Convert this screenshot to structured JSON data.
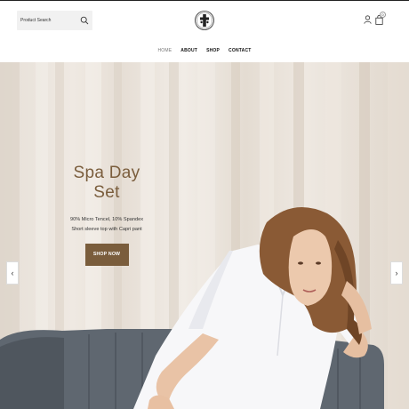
{
  "header": {
    "search": {
      "placeholder": "Product Search",
      "icon": "search-icon"
    },
    "logo": "brand-logo",
    "cart_count": "0"
  },
  "nav": {
    "items": [
      {
        "label": "HOME",
        "active": true
      },
      {
        "label": "ABOUT",
        "active": false
      },
      {
        "label": "SHOP",
        "active": false
      },
      {
        "label": "CONTACT",
        "active": false
      }
    ]
  },
  "hero": {
    "title": "Spa Day Set",
    "subtitle_line1": "90% Micro Tencel, 10% Spandex",
    "subtitle_line2": "Short sleeve top with Capri pant",
    "cta": "SHOP NOW",
    "prev_arrow": "‹",
    "next_arrow": "›"
  },
  "colors": {
    "accent": "#7a5d3c",
    "background": "#ffffff",
    "curtain": "#ebe4dc",
    "sofa": "#5e6670"
  }
}
